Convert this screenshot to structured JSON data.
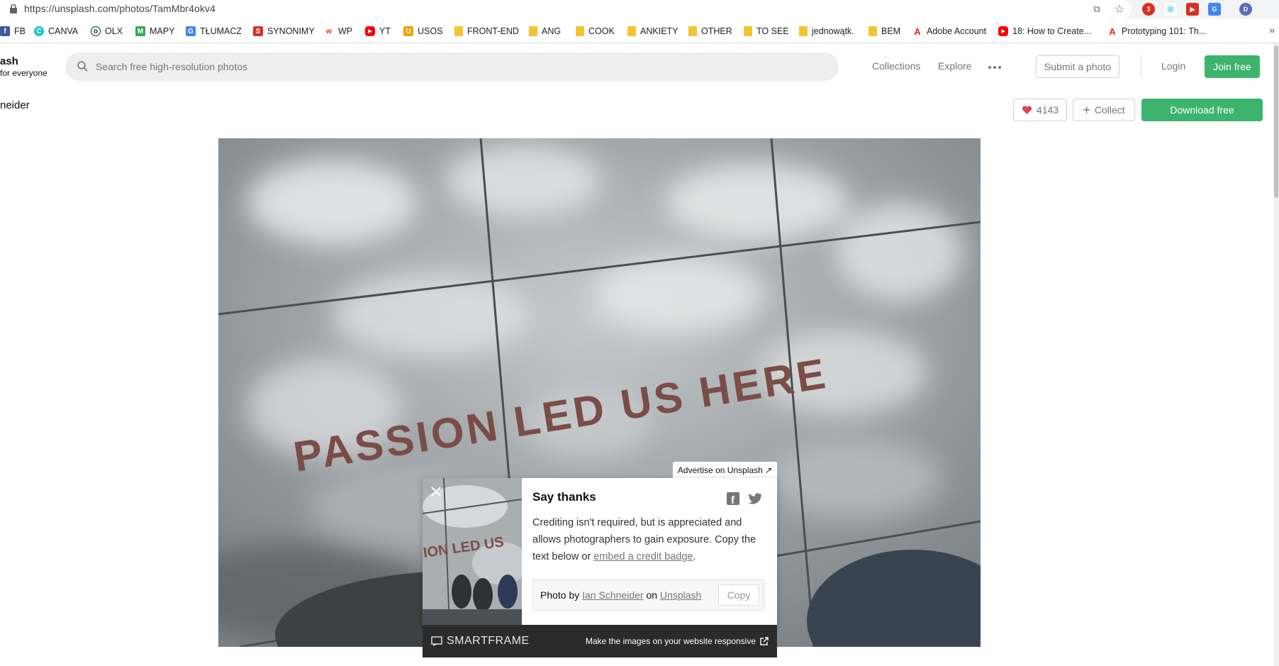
{
  "browser": {
    "url": "https://unsplash.com/photos/TamMbr4okv4",
    "profile_initial": "D",
    "ext_badge": "3"
  },
  "bookmarks": {
    "items": [
      {
        "label": "FB",
        "icon": "facebook-icon",
        "color": "#3b5998",
        "glyph": "f"
      },
      {
        "label": "CANVA",
        "icon": "canva-icon",
        "color": "#20c4cb",
        "glyph": "C"
      },
      {
        "label": "OLX",
        "icon": "olx-icon",
        "color": "#002f34",
        "glyph": "o"
      },
      {
        "label": "MAPY",
        "icon": "maps-icon",
        "color": "#34a853",
        "glyph": "M"
      },
      {
        "label": "TŁUMACZ",
        "icon": "translate-icon",
        "color": "#4285f4",
        "glyph": "G"
      },
      {
        "label": "SYNONIMY",
        "icon": "synonimy-icon",
        "color": "#d93025",
        "glyph": "S"
      },
      {
        "label": "WP",
        "icon": "wp-icon",
        "color": "#e32d2d",
        "glyph": "w"
      },
      {
        "label": "YT",
        "icon": "youtube-icon",
        "color": "#ff0000",
        "glyph": "▶"
      },
      {
        "label": "USOS",
        "icon": "usos-icon",
        "color": "#f4a300",
        "glyph": "U"
      },
      {
        "label": "FRONT-END",
        "icon": "folder-icon"
      },
      {
        "label": "ANG",
        "icon": "folder-icon"
      },
      {
        "label": "COOK",
        "icon": "folder-icon"
      },
      {
        "label": "ANKIETY",
        "icon": "folder-icon"
      },
      {
        "label": "OTHER",
        "icon": "folder-icon"
      },
      {
        "label": "TO SEE",
        "icon": "folder-icon"
      },
      {
        "label": "jednowątk.",
        "icon": "folder-icon"
      },
      {
        "label": "BEM",
        "icon": "folder-icon"
      },
      {
        "label": "Adobe Account",
        "icon": "adobe-icon",
        "color": "#ed1c24",
        "glyph": "A"
      },
      {
        "label": "18: How to Create...",
        "icon": "youtube-icon",
        "color": "#ff0000",
        "glyph": "▶"
      },
      {
        "label": "Prototyping 101: Th...",
        "icon": "adobe-icon",
        "color": "#ed1c24",
        "glyph": "A"
      }
    ],
    "more": "»"
  },
  "header": {
    "brand_name": "ash",
    "brand_tagline": " for everyone",
    "search_placeholder": "Search free high-resolution photos",
    "nav": [
      "Collections",
      "Explore"
    ],
    "submit_label": "Submit a photo",
    "login_label": "Login",
    "join_label": "Join free"
  },
  "photo_bar": {
    "author": "neider",
    "likes": "4143",
    "collect_label": "Collect",
    "download_label": "Download free"
  },
  "photo": {
    "headline": "PASSION LED US HERE",
    "thumb_text": "ION LED US"
  },
  "popup": {
    "ad_label": "Advertise on Unsplash ↗",
    "title": "Say thanks",
    "body_prefix": "Crediting isn't required, but is appreciated and allows photographers to gain exposure. Copy the text below or ",
    "body_link": "embed a credit badge",
    "body_suffix": ".",
    "credit_prefix": "Photo by ",
    "credit_author": "Ian Schneider",
    "credit_mid": " on ",
    "credit_site": "Unsplash",
    "copy_label": "Copy"
  },
  "smartframe": {
    "logo": "SMARTFRAME",
    "tagline": "Make the images on your website responsive"
  },
  "colors": {
    "accent_green": "#3cb46e",
    "heart_red": "#e0464c"
  }
}
